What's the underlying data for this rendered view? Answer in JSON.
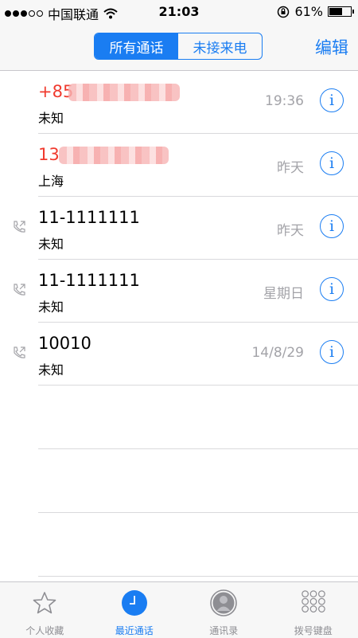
{
  "status_bar": {
    "carrier": "中国联通",
    "time": "21:03",
    "battery_percent": "61%",
    "battery_level": 0.61,
    "signal_bars_filled": 3,
    "signal_bars_total": 5
  },
  "nav": {
    "segments": [
      "所有通话",
      "未接来电"
    ],
    "active_segment": 0,
    "edit_label": "编辑"
  },
  "calls": [
    {
      "number": "+85",
      "location": "未知",
      "time": "19:36",
      "missed": true,
      "outgoing": false,
      "blurred": true
    },
    {
      "number": "13",
      "location": "上海",
      "time": "昨天",
      "missed": true,
      "outgoing": false,
      "blurred": true
    },
    {
      "number": "11-1111111",
      "location": "未知",
      "time": "昨天",
      "missed": false,
      "outgoing": true,
      "blurred": false
    },
    {
      "number": "11-1111111",
      "location": "未知",
      "time": "星期日",
      "missed": false,
      "outgoing": true,
      "blurred": false
    },
    {
      "number": "10010",
      "location": "未知",
      "time": "14/8/29",
      "missed": false,
      "outgoing": true,
      "blurred": false
    }
  ],
  "tab_bar": {
    "tabs": [
      {
        "label": "个人收藏",
        "icon": "star-icon"
      },
      {
        "label": "最近通话",
        "icon": "clock-icon"
      },
      {
        "label": "通讯录",
        "icon": "contacts-icon"
      },
      {
        "label": "拨号键盘",
        "icon": "keypad-icon"
      }
    ],
    "active_tab": 1
  },
  "colors": {
    "accent": "#1a7df2",
    "missed": "#f03a2e",
    "secondary_text": "#a3a3a8"
  }
}
